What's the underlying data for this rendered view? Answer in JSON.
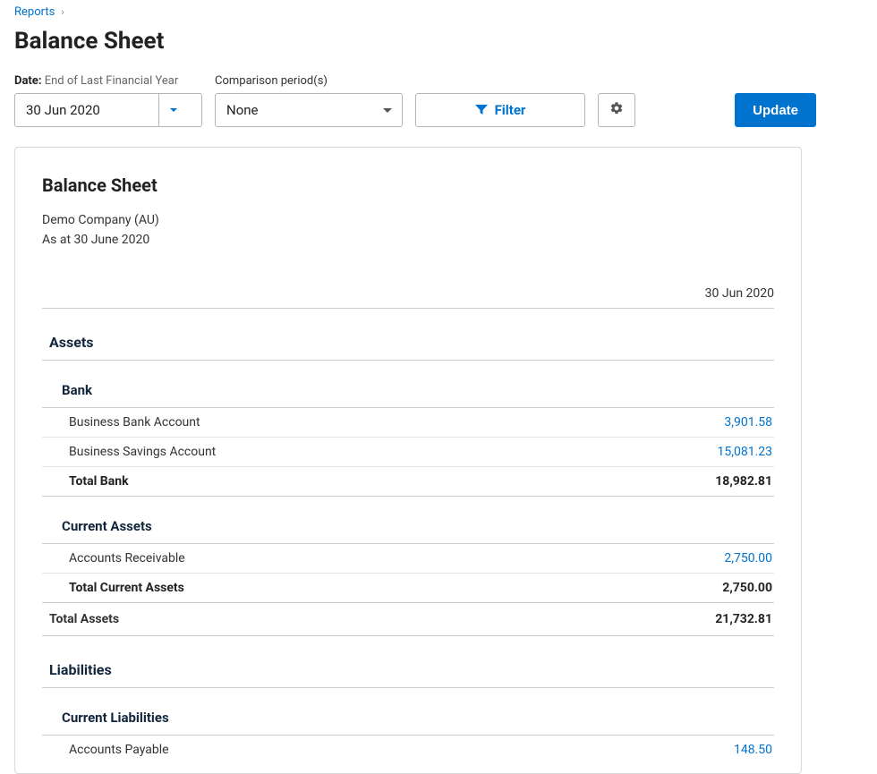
{
  "breadcrumb": {
    "link": "Reports"
  },
  "page_title": "Balance Sheet",
  "controls": {
    "date_label_bold": "Date:",
    "date_label_sub": "End of Last Financial Year",
    "date_value": "30 Jun 2020",
    "comparison_label": "Comparison period(s)",
    "comparison_value": "None",
    "filter_label": "Filter",
    "update_label": "Update"
  },
  "report": {
    "title": "Balance Sheet",
    "company": "Demo Company (AU)",
    "as_at": "As at 30 June 2020",
    "column_date": "30 Jun 2020"
  },
  "sections": {
    "assets": {
      "heading": "Assets",
      "bank": {
        "heading": "Bank",
        "rows": [
          {
            "label": "Business Bank Account",
            "value": "3,901.58"
          },
          {
            "label": "Business Savings Account",
            "value": "15,081.23"
          }
        ],
        "total_label": "Total Bank",
        "total_value": "18,982.81"
      },
      "current_assets": {
        "heading": "Current Assets",
        "rows": [
          {
            "label": "Accounts Receivable",
            "value": "2,750.00"
          }
        ],
        "total_label": "Total Current Assets",
        "total_value": "2,750.00"
      },
      "total_label": "Total Assets",
      "total_value": "21,732.81"
    },
    "liabilities": {
      "heading": "Liabilities",
      "current_liabilities": {
        "heading": "Current Liabilities",
        "rows": [
          {
            "label": "Accounts Payable",
            "value": "148.50"
          }
        ]
      }
    }
  }
}
